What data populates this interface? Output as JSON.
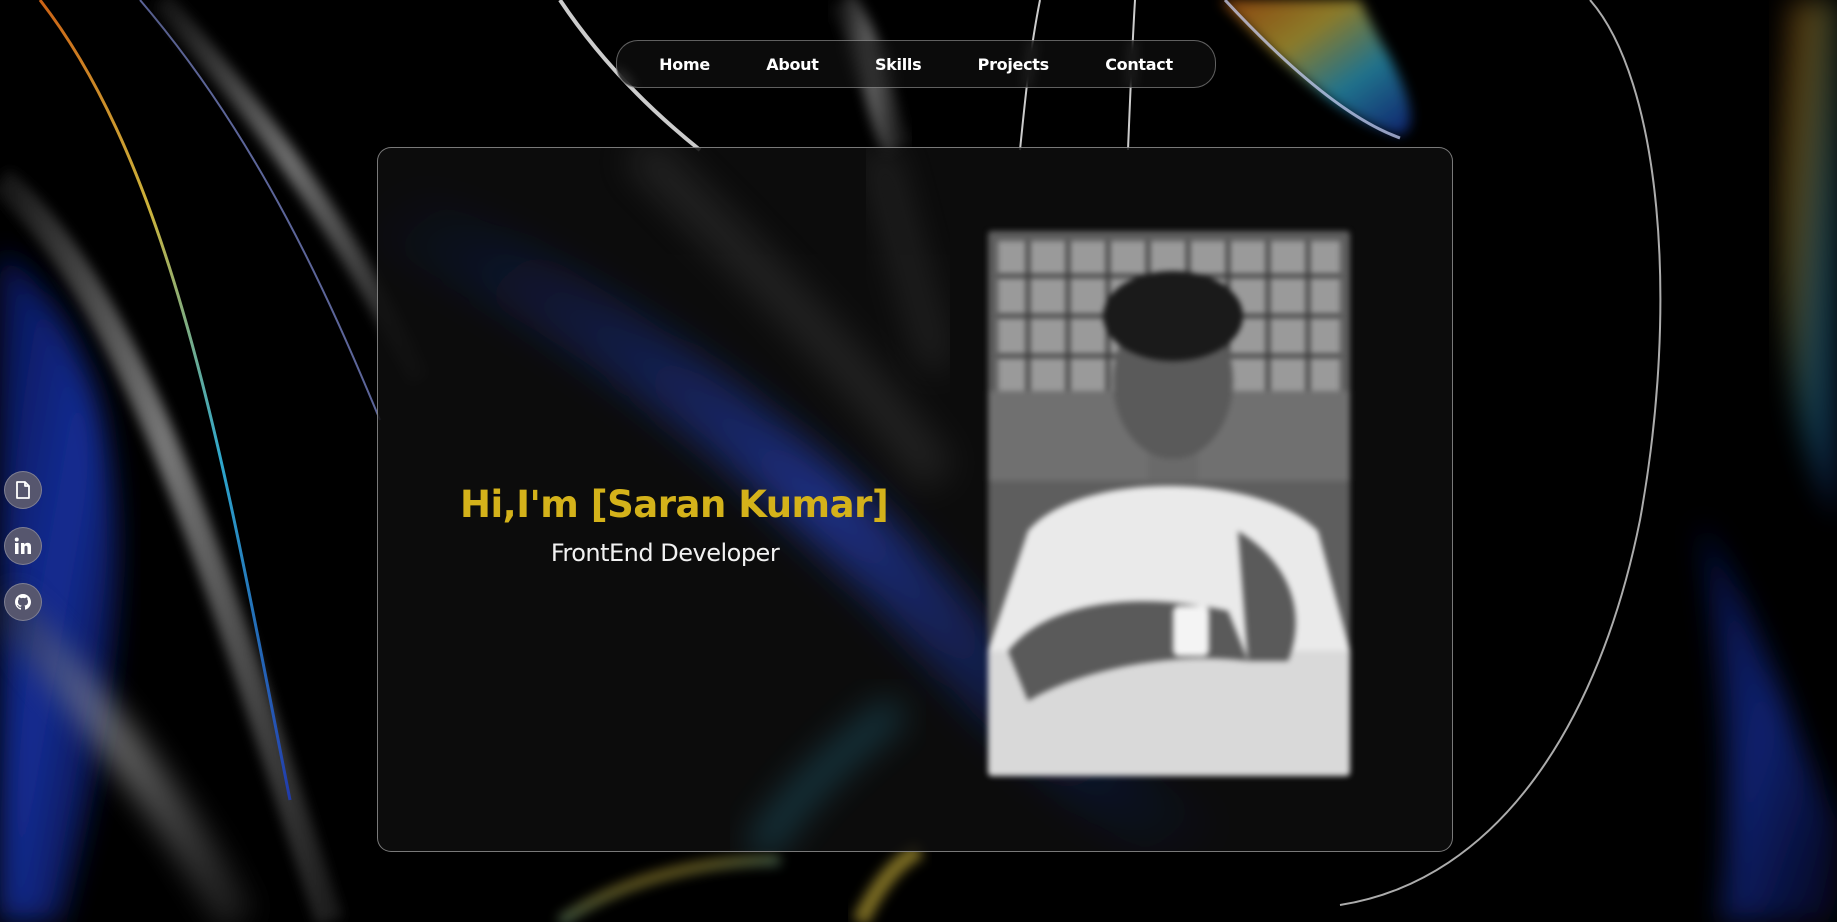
{
  "nav": {
    "items": [
      {
        "label": "Home"
      },
      {
        "label": "About"
      },
      {
        "label": "Skills"
      },
      {
        "label": "Projects"
      },
      {
        "label": "Contact"
      }
    ]
  },
  "hero": {
    "title": "Hi,I'm [Saran Kumar]",
    "subtitle": "FrontEnd Developer"
  },
  "social": {
    "icons": [
      "document-icon",
      "linkedin-icon",
      "github-icon"
    ]
  },
  "colors": {
    "accent": "#d4b21a",
    "background": "#000000",
    "social_button": "#56566e"
  }
}
